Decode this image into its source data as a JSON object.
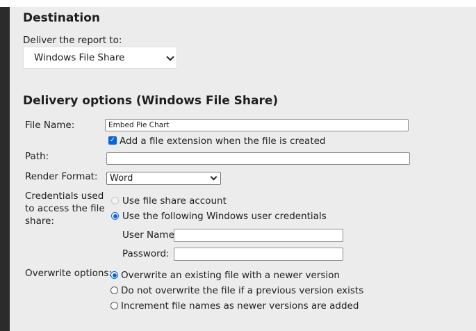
{
  "destination": {
    "heading": "Destination",
    "deliver_label": "Deliver the report to:",
    "deliver_value": "Windows File Share"
  },
  "delivery": {
    "heading": "Delivery options (Windows File Share)",
    "file_name_label": "File Name:",
    "file_name_value": "Embed Pie Chart",
    "add_extension_label": "Add a file extension when the file is created",
    "add_extension_checked": true,
    "path_label": "Path:",
    "path_value": "",
    "render_format_label": "Render Format:",
    "render_format_value": "Word",
    "credentials_label_1": "Credentials used",
    "credentials_label_2": "to access the file",
    "credentials_label_3": "share:",
    "use_share_account_label": "Use file share account",
    "use_windows_creds_label": "Use the following Windows user credentials",
    "user_name_label": "User Name:",
    "user_name_value": "",
    "password_label": "Password:",
    "password_value": "",
    "overwrite_label": "Overwrite options:",
    "overwrite_options": [
      "Overwrite an existing file with a newer version",
      "Do not overwrite the file if a previous version exists",
      "Increment file names as newer versions are added"
    ],
    "overwrite_selected_index": 0
  },
  "colors": {
    "accent": "#0a64d4",
    "panel_bg": "#ececec",
    "left_bar": "#2b2b2b"
  }
}
